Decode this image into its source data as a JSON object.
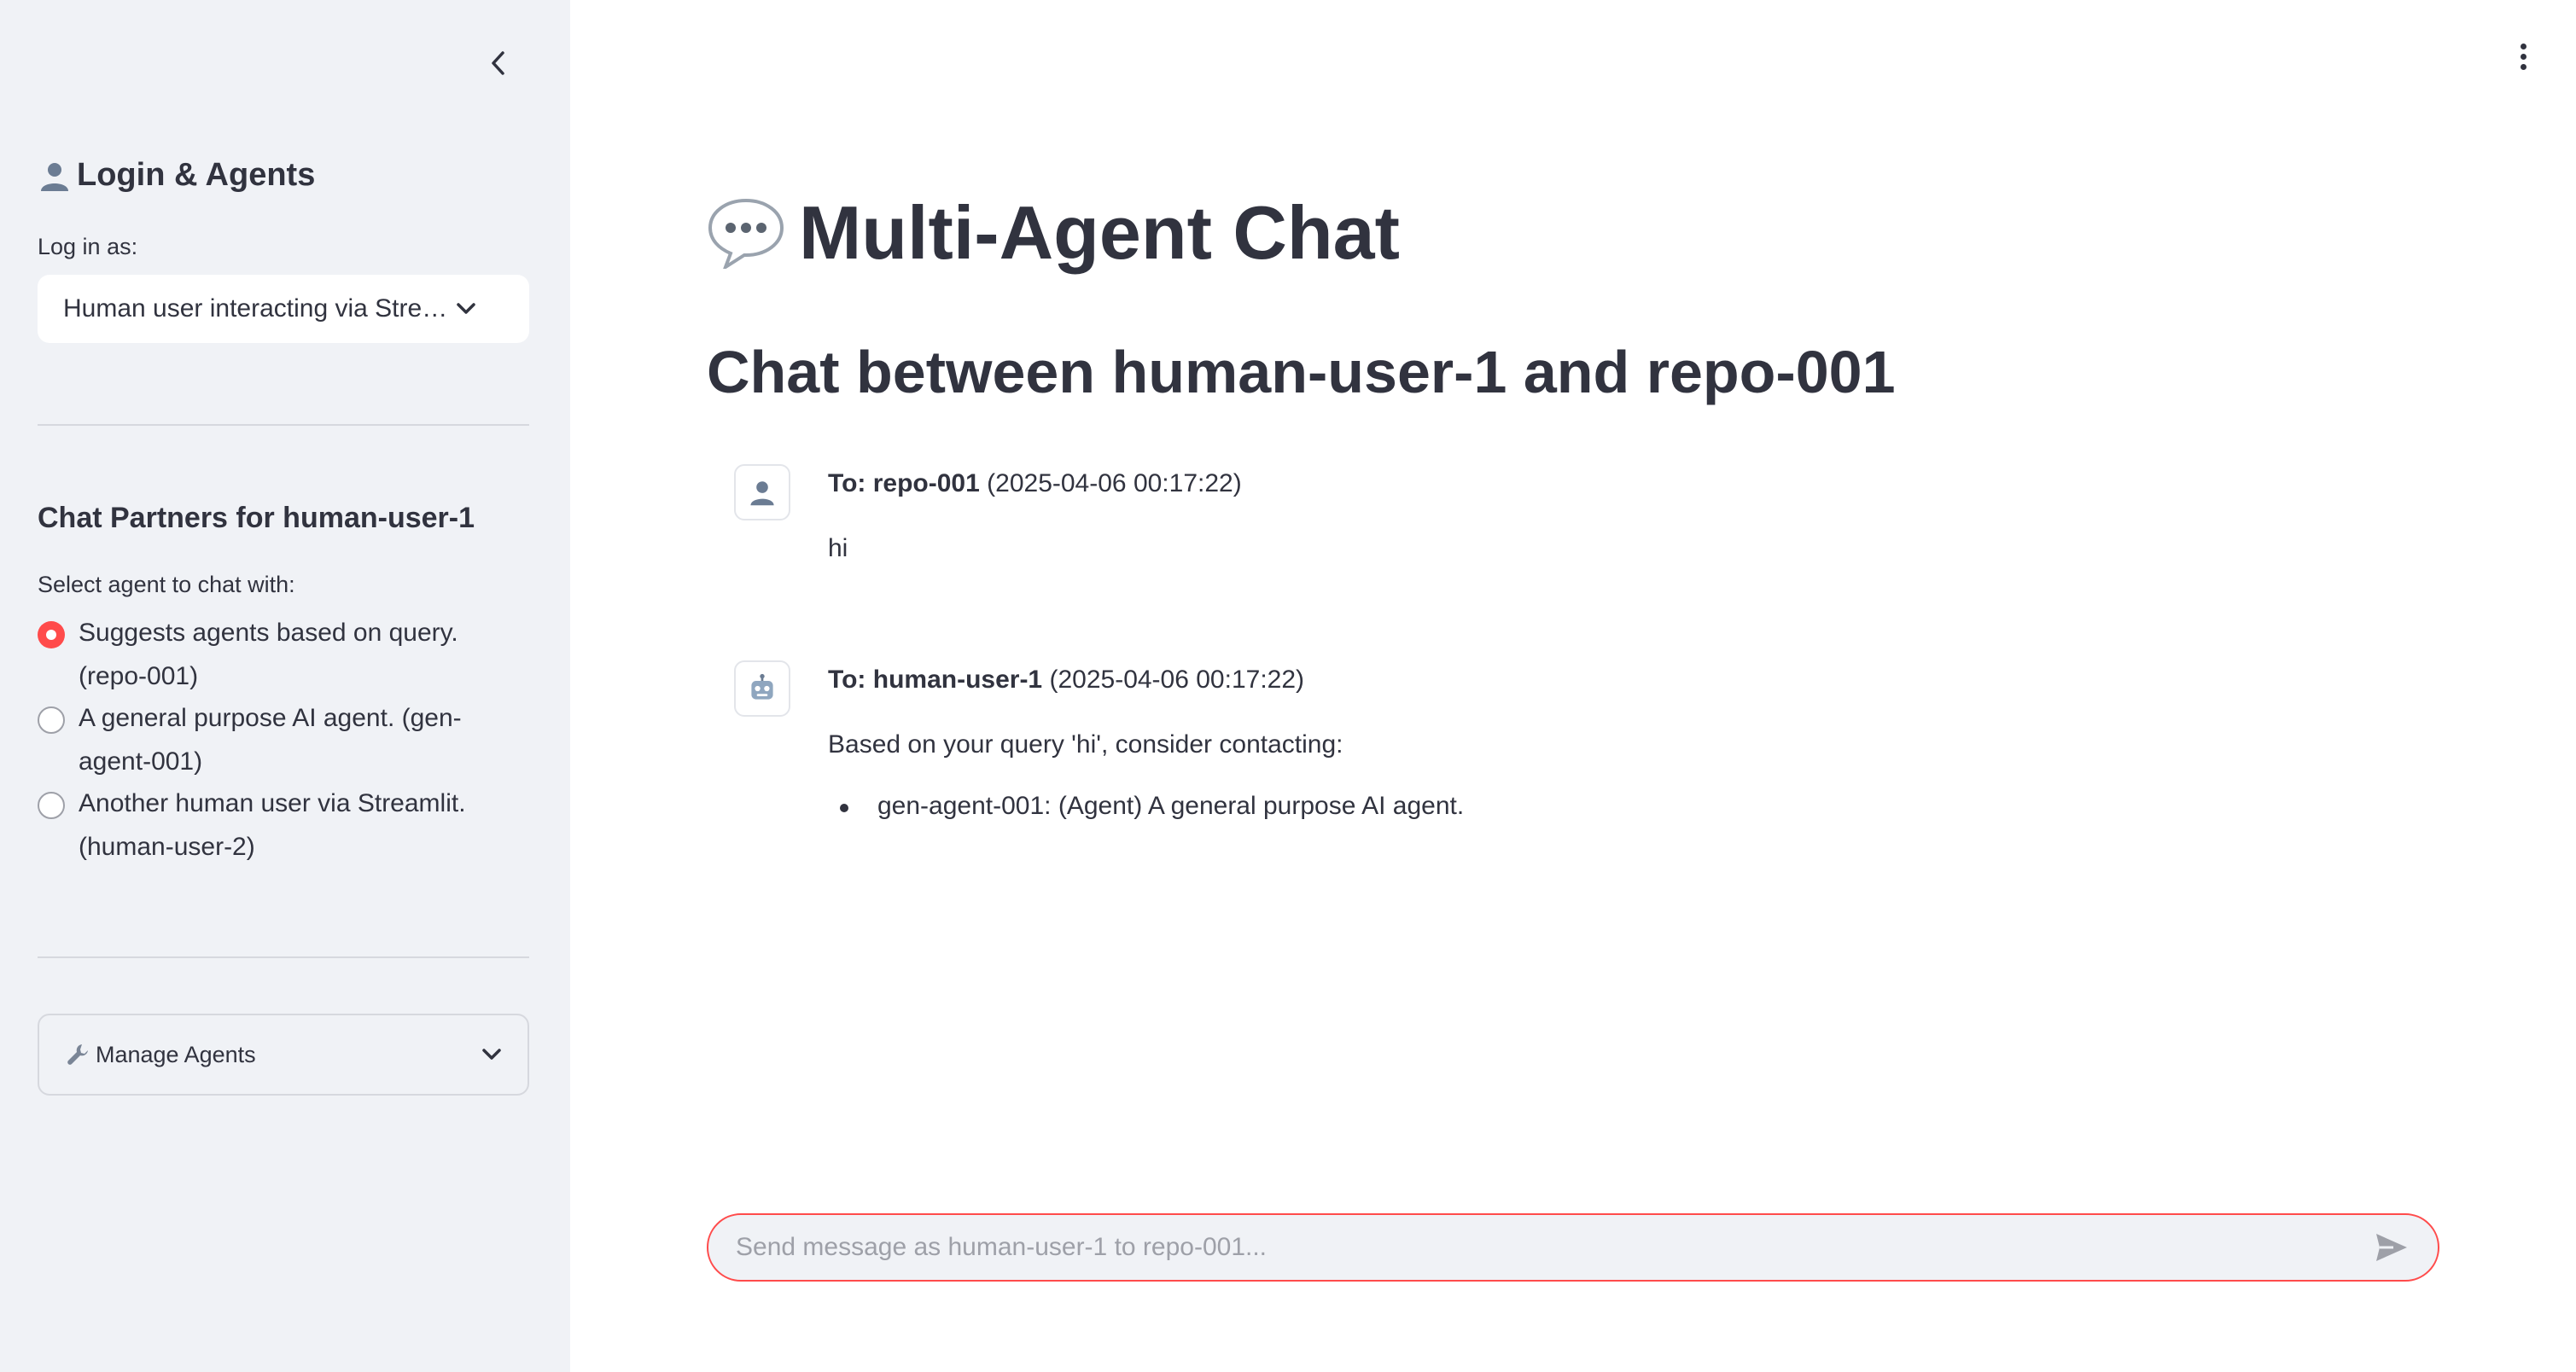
{
  "sidebar": {
    "heading": "Login & Agents",
    "login_label": "Log in as:",
    "login_select_value": "Human user interacting via Stre…",
    "partners_heading": "Chat Partners for human-user-1",
    "select_agent_label": "Select agent to chat with:",
    "agents": [
      {
        "label": "Suggests agents based on query. (repo-001)",
        "selected": true
      },
      {
        "label": "A general purpose AI agent. (gen-agent-001)",
        "selected": false
      },
      {
        "label": "Another human user via Streamlit. (human-user-2)",
        "selected": false
      }
    ],
    "manage_agents_label": "Manage Agents"
  },
  "main": {
    "title": "Multi-Agent Chat",
    "subtitle": "Chat between human-user-1 and repo-001",
    "messages": [
      {
        "to_label": "To: repo-001",
        "timestamp": "(2025-04-06 00:17:22)",
        "text": "hi",
        "avatar_icon": "user-icon"
      },
      {
        "to_label": "To: human-user-1",
        "timestamp": "(2025-04-06 00:17:22)",
        "text": "Based on your query 'hi', consider contacting:",
        "list": [
          "gen-agent-001: (Agent) A general purpose AI agent."
        ],
        "avatar_icon": "robot-icon"
      }
    ],
    "input_placeholder": "Send message as human-user-1 to repo-001..."
  },
  "colors": {
    "accent": "#ff4b4b",
    "sidebar_bg": "#f0f2f6",
    "text": "#31333f"
  }
}
